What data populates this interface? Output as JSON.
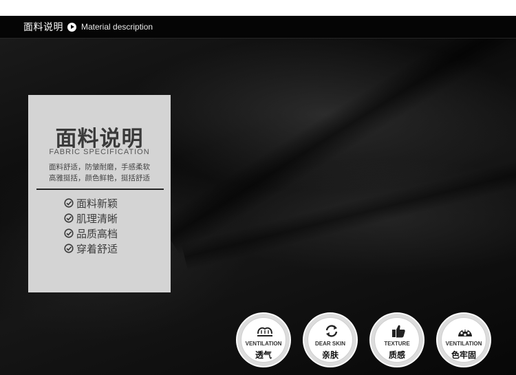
{
  "header": {
    "title_cn": "面料说明",
    "title_en": "Material description"
  },
  "card": {
    "title": "面料说明",
    "subtitle": "FABRIC SPECIFICATION",
    "desc_line1": "面料舒适，防皱耐磨，手感柔软",
    "desc_line2": "高雅挺括，颜色鲜艳，挺括舒适",
    "features": [
      "面料新颖",
      "肌理清晰",
      "品质高档",
      "穿着舒适"
    ]
  },
  "badges": [
    {
      "en": "VENTILATION",
      "cn": "透气",
      "icon": "ventilation-icon"
    },
    {
      "en": "DEAR SKIN",
      "cn": "亲肤",
      "icon": "refresh-icon"
    },
    {
      "en": "TEXTURE",
      "cn": "质感",
      "icon": "thumbs-up-icon"
    },
    {
      "en": "VENTILATION",
      "cn": "色牢固",
      "icon": "palette-icon"
    }
  ],
  "colors": {
    "header_bg": "#050505",
    "card_bg": "#d4d4d4",
    "fabric": "#0b0b0b"
  }
}
